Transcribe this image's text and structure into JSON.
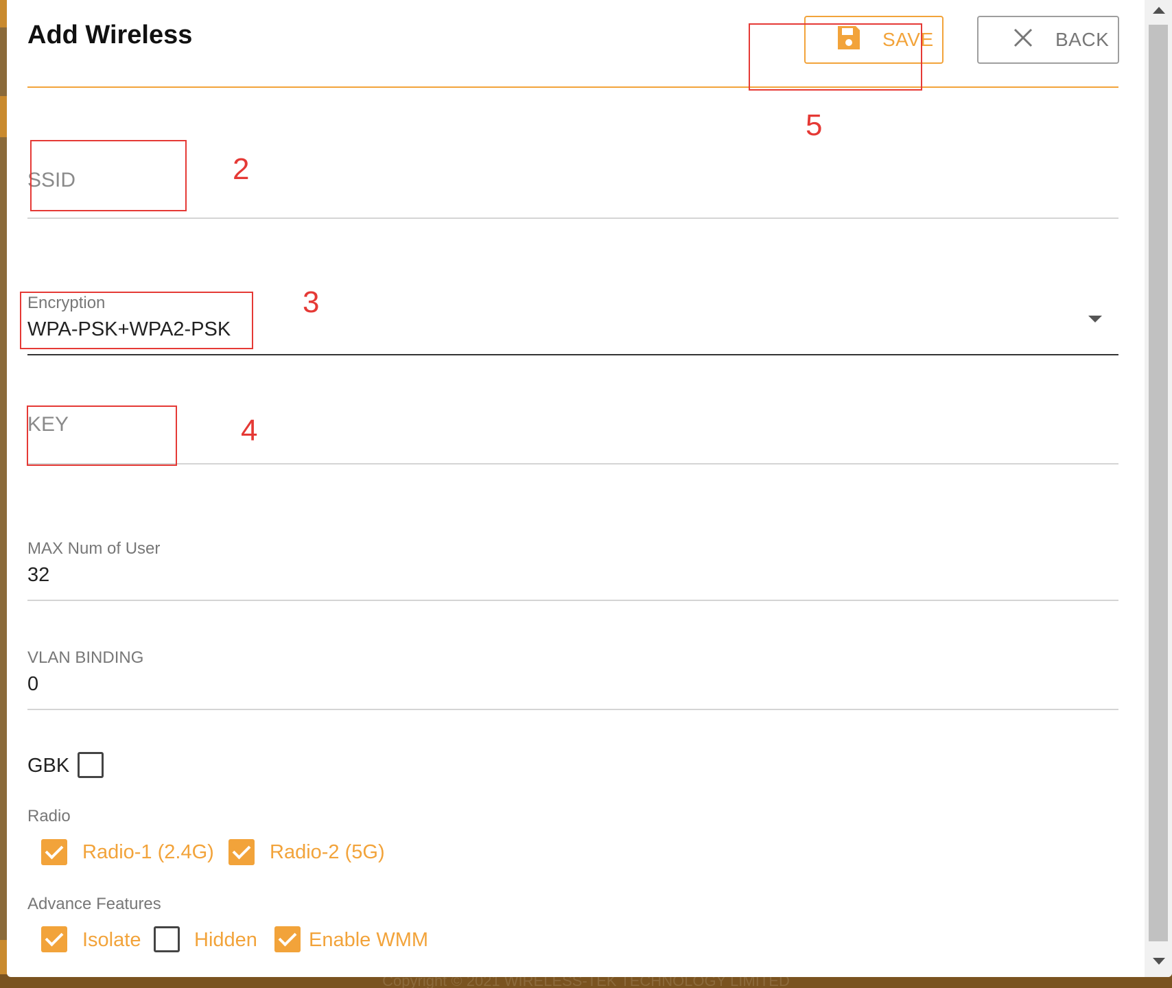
{
  "dialog": {
    "title": "Add Wireless",
    "save_label": "SAVE",
    "back_label": "BACK"
  },
  "form": {
    "ssid": {
      "placeholder": "SSID",
      "value": ""
    },
    "encryption": {
      "label": "Encryption",
      "value": "WPA-PSK+WPA2-PSK"
    },
    "key": {
      "placeholder": "KEY",
      "value": ""
    },
    "max_users": {
      "label": "MAX Num of User",
      "value": "32"
    },
    "vlan": {
      "label": "VLAN BINDING",
      "value": "0"
    },
    "gbk": {
      "label": "GBK",
      "checked": false
    }
  },
  "radio": {
    "section_label": "Radio",
    "options": [
      {
        "label": "Radio-1 (2.4G)",
        "checked": true
      },
      {
        "label": "Radio-2 (5G)",
        "checked": true
      }
    ]
  },
  "advance": {
    "section_label": "Advance Features",
    "options": [
      {
        "label": "Isolate",
        "checked": true
      },
      {
        "label": "Hidden",
        "checked": false
      },
      {
        "label": "Enable WMM",
        "checked": true
      }
    ]
  },
  "annotations": [
    "2",
    "3",
    "4",
    "5"
  ],
  "footer": {
    "text": "Copyright © 2021 WIRELESS-TEK TECHNOLOGY LIMITED"
  },
  "colors": {
    "accent": "#f2a33a",
    "annotation": "#e53935"
  },
  "icons": {
    "save": "floppy-disk-icon",
    "back": "close-x-icon",
    "select": "caret-down-icon"
  }
}
